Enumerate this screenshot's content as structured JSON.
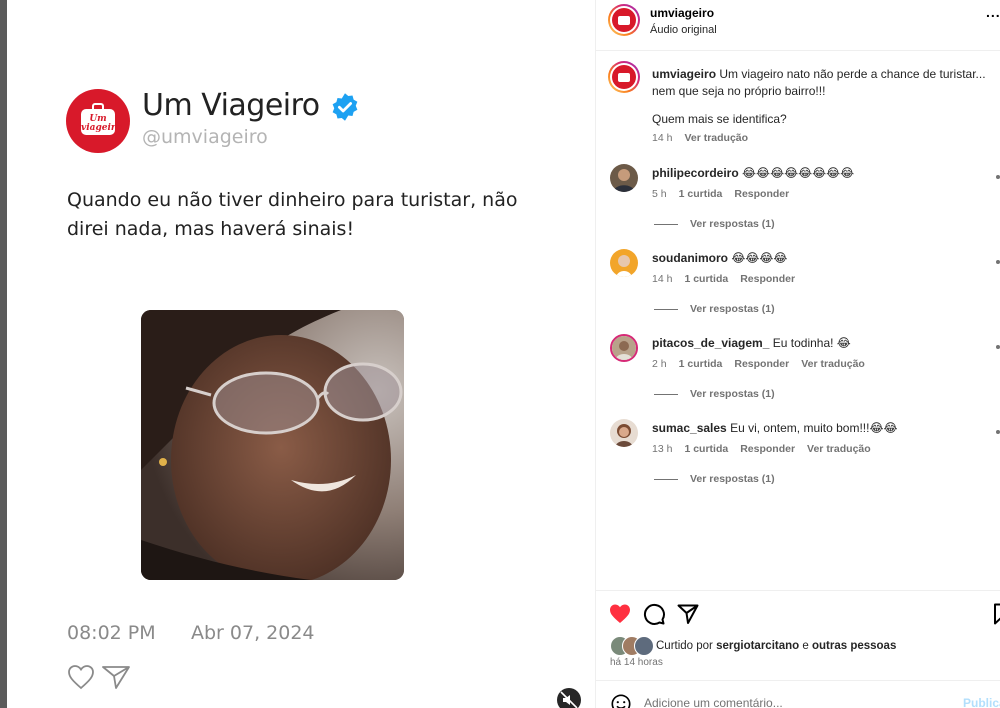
{
  "tweet": {
    "logo_text": "Um viageiro",
    "name": "Um Viageiro",
    "handle": "@umviageiro",
    "text": "Quando eu não tiver dinheiro para turistar, não direi nada, mas haverá sinais!",
    "time": "08:02 PM",
    "date": "Abr 07, 2024"
  },
  "header": {
    "username": "umviageiro",
    "audio": "Áudio original",
    "more": "..."
  },
  "caption": {
    "username": "umviageiro",
    "text": "Um viageiro nato não perde a chance de turistar... nem que seja no próprio bairro!!!",
    "question": "Quem mais se identifica?",
    "time": "14 h",
    "translate": "Ver tradução"
  },
  "comments": [
    {
      "username": "philipecordeiro",
      "text": "😂😂😂😂😂😂😂😂",
      "time": "5 h",
      "likes": "1 curtida",
      "reply": "Responder",
      "translate": "",
      "replies": "Ver respostas (1)"
    },
    {
      "username": "soudanimoro",
      "text": "😂😂😂😂",
      "time": "14 h",
      "likes": "1 curtida",
      "reply": "Responder",
      "translate": "",
      "replies": "Ver respostas (1)"
    },
    {
      "username": "pitacos_de_viagem_",
      "text": "Eu todinha! 😂",
      "time": "2 h",
      "likes": "1 curtida",
      "reply": "Responder",
      "translate": "Ver tradução",
      "replies": "Ver respostas (1)"
    },
    {
      "username": "sumac_sales",
      "text": "Eu vi, ontem, muito bom!!!😂😂",
      "time": "13 h",
      "likes": "1 curtida",
      "reply": "Responder",
      "translate": "Ver tradução",
      "replies": "Ver respostas (1)"
    }
  ],
  "likes": {
    "prefix": "Curtido por",
    "user": "sergiotarcitano",
    "conj": "e",
    "others": "outras pessoas",
    "time_ago": "há 14 horas"
  },
  "add_comment": {
    "placeholder": "Adicione um comentário...",
    "publish": "Publicar"
  },
  "colors": {
    "brand_red": "#d8192a",
    "like_red": "#ff3040",
    "verified_blue": "#1da1f2",
    "publish_disabled": "#b2dffc"
  }
}
